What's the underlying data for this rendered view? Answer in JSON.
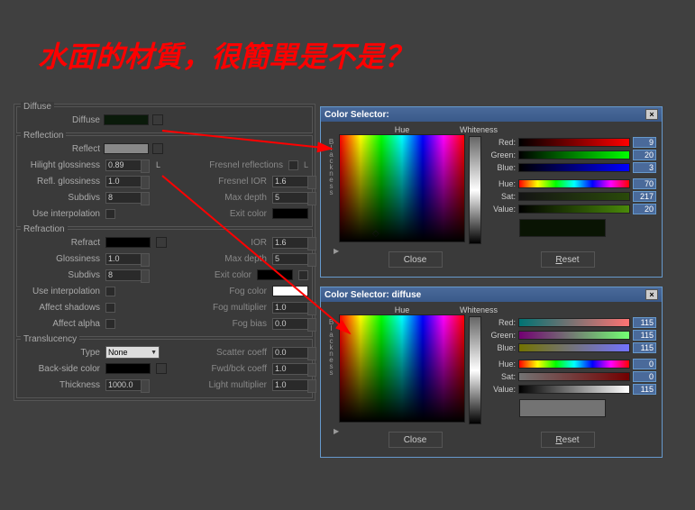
{
  "title": "水面的材質，很簡單是不是？",
  "sections": {
    "diffuse": {
      "title": "Diffuse",
      "label": "Diffuse",
      "color": "#0a1a0a"
    },
    "reflection": {
      "title": "Reflection",
      "reflect_label": "Reflect",
      "reflect_color": "#888888",
      "hilight_label": "Hilight glossiness",
      "hilight_val": "0.89",
      "l_label": "L",
      "fresnel_label": "Fresnel reflections",
      "refl_gloss_label": "Refl. glossiness",
      "refl_gloss_val": "1.0",
      "fresnel_ior_label": "Fresnel IOR",
      "fresnel_ior_val": "1.6",
      "subdivs_label": "Subdivs",
      "subdivs_val": "8",
      "maxdepth_label": "Max depth",
      "maxdepth_val": "5",
      "interp_label": "Use interpolation",
      "exit_label": "Exit color",
      "exit_color": "#000000"
    },
    "refraction": {
      "title": "Refraction",
      "refract_label": "Refract",
      "refract_color": "#000000",
      "ior_label": "IOR",
      "ior_val": "1.6",
      "gloss_label": "Glossiness",
      "gloss_val": "1.0",
      "maxdepth_label": "Max depth",
      "maxdepth_val": "5",
      "subdivs_label": "Subdivs",
      "subdivs_val": "8",
      "exit_label": "Exit color",
      "exit_color": "#000000",
      "interp_label": "Use interpolation",
      "fog_label": "Fog color",
      "fog_color": "#ffffff",
      "shadows_label": "Affect shadows",
      "fogmult_label": "Fog multiplier",
      "fogmult_val": "1.0",
      "alpha_label": "Affect alpha",
      "fogbias_label": "Fog bias",
      "fogbias_val": "0.0"
    },
    "translucency": {
      "title": "Translucency",
      "type_label": "Type",
      "type_val": "None",
      "scatter_label": "Scatter coeff",
      "scatter_val": "0.0",
      "back_label": "Back-side color",
      "back_color": "#000000",
      "fwdback_label": "Fwd/bck coeff",
      "fwdback_val": "1.0",
      "thickness_label": "Thickness",
      "thickness_val": "1000.0",
      "lightmult_label": "Light multiplier",
      "lightmult_val": "1.0"
    }
  },
  "color_selector_1": {
    "title": "Color Selector:",
    "hue": "Hue",
    "whiteness": "Whiteness",
    "blackness": "Blackness",
    "red_label": "Red:",
    "red_val": "9",
    "green_label": "Green:",
    "green_val": "20",
    "blue_label": "Blue:",
    "blue_val": "3",
    "hue_label": "Hue:",
    "hue_val": "70",
    "sat_label": "Sat:",
    "sat_val": "217",
    "value_label": "Value:",
    "value_val": "20",
    "preview_color": "#091403",
    "close": "Close",
    "reset": "Reset"
  },
  "color_selector_2": {
    "title": "Color Selector: diffuse",
    "hue": "Hue",
    "whiteness": "Whiteness",
    "blackness": "Blackness",
    "red_label": "Red:",
    "red_val": "115",
    "green_label": "Green:",
    "green_val": "115",
    "blue_label": "Blue:",
    "blue_val": "115",
    "hue_label": "Hue:",
    "hue_val": "0",
    "sat_label": "Sat:",
    "sat_val": "0",
    "value_label": "Value:",
    "value_val": "115",
    "preview_color": "#737373",
    "close": "Close",
    "reset": "Reset"
  }
}
